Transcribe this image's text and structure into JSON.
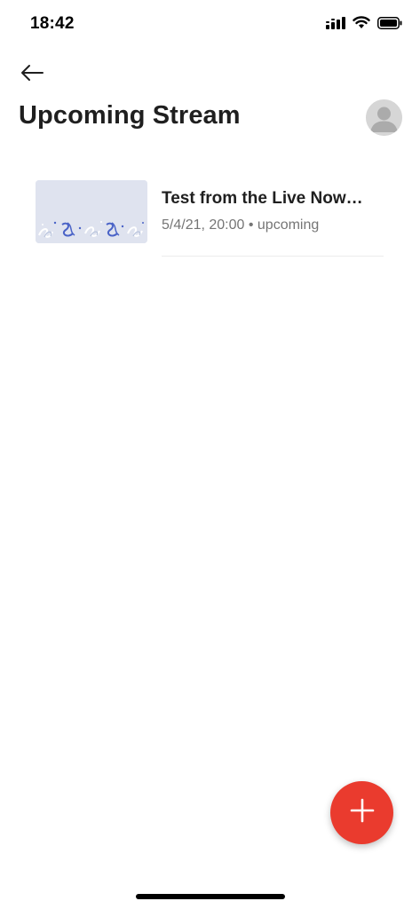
{
  "status_bar": {
    "time": "18:42",
    "icons": [
      "cellular-signal-icon",
      "wifi-icon",
      "battery-icon"
    ]
  },
  "header": {
    "back_icon": "arrow-left-icon",
    "title": "Upcoming Stream",
    "avatar_icon": "user-avatar-icon"
  },
  "streams": [
    {
      "title": "Test from the Live Now…",
      "meta": "5/4/21, 20:00 • upcoming",
      "thumbnail": "confetti-thumbnail"
    }
  ],
  "fab": {
    "icon": "plus-icon",
    "color": "#ea3b2e"
  },
  "colors": {
    "accent": "#ea3b2e",
    "text_primary": "#1f1f1f",
    "text_secondary": "#757575",
    "thumbnail_bg": "#dfe3ef"
  }
}
